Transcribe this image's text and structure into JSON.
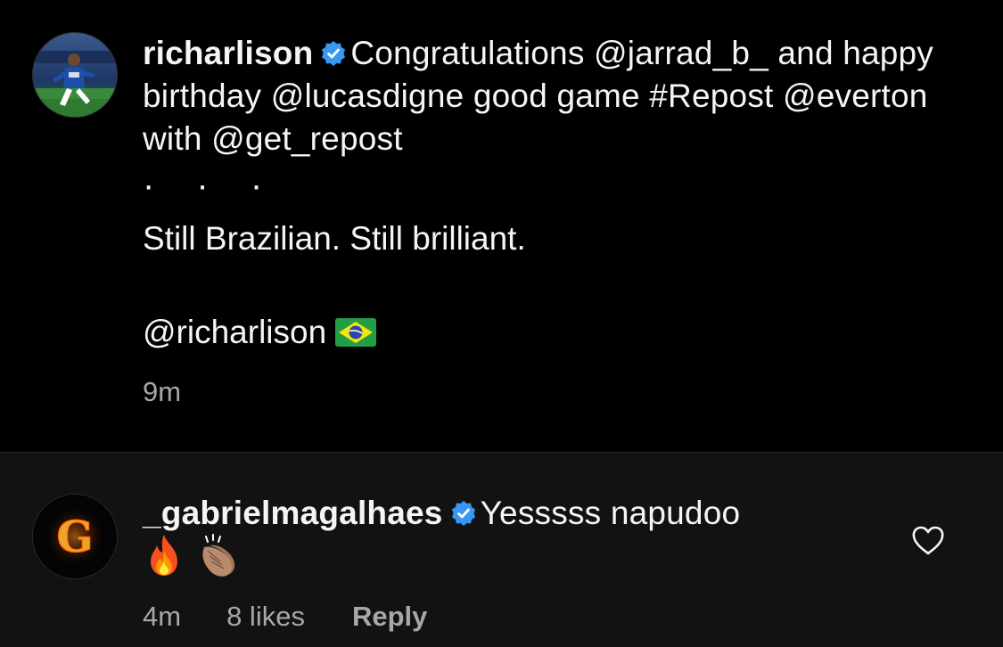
{
  "post": {
    "author": "richarlison",
    "verified": true,
    "caption_first": "Congratulations @jarrad_b_ and happy birthday @lucasdigne good game #Repost @everton with @get_repost",
    "dots": "· · ·",
    "caption_line2": "Still Brazilian. Still brilliant.",
    "caption_line3": "@richarlison",
    "flag_icon": "brazil-flag-icon",
    "time": "9m"
  },
  "comment": {
    "author": "_gabrielmagalhaes",
    "verified": true,
    "text": "Yesssss napudoo",
    "emojis": [
      "fire-emoji-icon",
      "clapping-hands-emoji-icon"
    ],
    "avatar_letter": "G",
    "time": "4m",
    "likes": "8 likes",
    "reply_label": "Reply"
  },
  "colors": {
    "background": "#000000",
    "comment_background": "#121212",
    "text": "#f5f5f5",
    "secondary_text": "#a8a8a8",
    "verified_blue": "#3897f0",
    "divider": "#262626"
  }
}
